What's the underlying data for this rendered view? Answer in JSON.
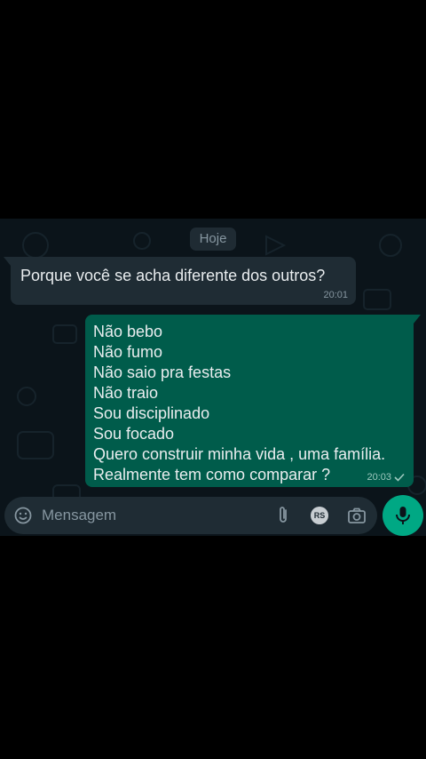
{
  "chat": {
    "date_chip": "Hoje",
    "incoming": {
      "text": "Porque você se acha diferente dos outros?",
      "time": "20:01"
    },
    "outgoing": {
      "lines": [
        "Não bebo",
        "Não fumo",
        "Não saio pra festas",
        "Não traio",
        "Sou disciplinado",
        "Sou focado",
        "Quero construir minha vida , uma família.",
        "Realmente tem como comparar ?"
      ],
      "time": "20:03",
      "status_icon": "single-check-icon"
    }
  },
  "composer": {
    "placeholder": "Mensagem",
    "rs_badge": "RS",
    "icons": [
      "emoji-icon",
      "paperclip-icon",
      "camera-icon",
      "microphone-icon"
    ]
  },
  "colors": {
    "background": "#0b141a",
    "incoming_bubble": "#1f2c34",
    "outgoing_bubble": "#005c4b",
    "accent": "#00a884"
  }
}
